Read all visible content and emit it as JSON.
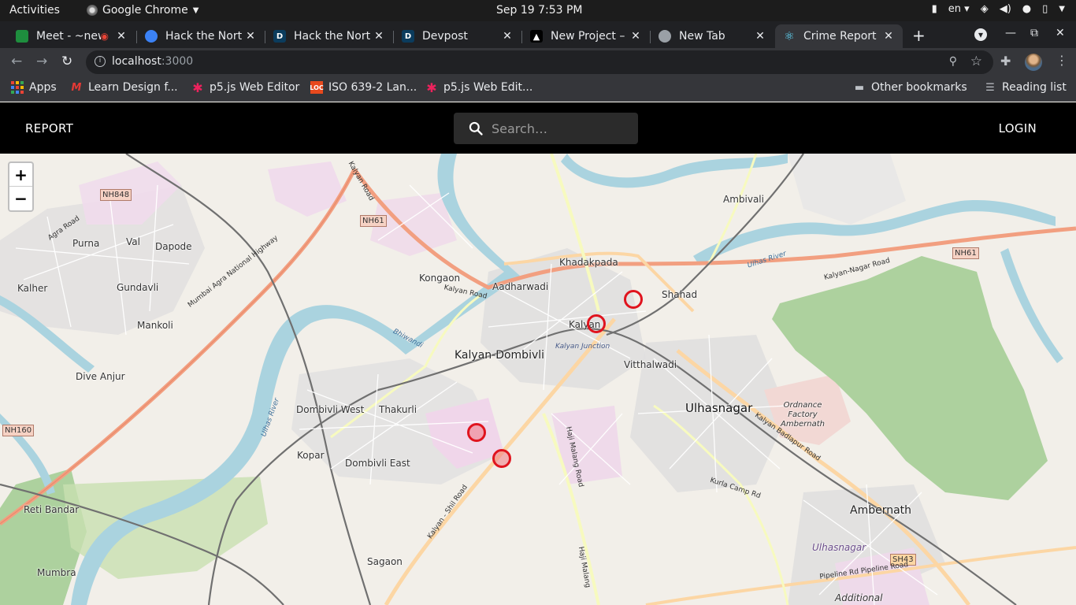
{
  "os_bar": {
    "activities": "Activities",
    "app_name": "Google Chrome",
    "clock": "Sep 19  7:53 PM",
    "lang": "en"
  },
  "tabs": [
    {
      "title": "Meet - ~new",
      "icon": "meet-icon",
      "color": "#1e8e3e"
    },
    {
      "title": "Hack the North",
      "icon": "globe-icon",
      "color": "#3b82f6"
    },
    {
      "title": "Hack the North",
      "icon": "devpost-icon",
      "color": "#0b3c5d"
    },
    {
      "title": "Devpost",
      "icon": "devpost-icon",
      "color": "#0b3c5d"
    },
    {
      "title": "New Project –",
      "icon": "vercel-icon",
      "color": "#000000"
    },
    {
      "title": "New Tab",
      "icon": "chrome-icon",
      "color": "#9aa0a6"
    },
    {
      "title": "Crime Report",
      "icon": "react-icon",
      "color": "#61dafb"
    }
  ],
  "address_bar": {
    "host": "localhost",
    "port": ":3000"
  },
  "bookmarks": [
    {
      "label": "Apps",
      "icon": "apps-grid-icon"
    },
    {
      "label": "Learn Design f...",
      "icon": "design-icon"
    },
    {
      "label": "p5.js Web Editor",
      "icon": "p5-star-icon"
    },
    {
      "label": "ISO 639-2 Lan...",
      "icon": "loc-icon"
    },
    {
      "label": "p5.js Web Edit...",
      "icon": "p5-star-icon"
    },
    {
      "label": "Other bookmarks",
      "icon": "folder-icon"
    },
    {
      "label": "Reading list",
      "icon": "reading-list-icon"
    }
  ],
  "app": {
    "report_label": "REPORT",
    "login_label": "LOGIN",
    "search_placeholder": "Search…"
  },
  "map": {
    "zoom_in": "+",
    "zoom_out": "−",
    "places": [
      {
        "name": "Ambivali"
      },
      {
        "name": "Purna"
      },
      {
        "name": "Val"
      },
      {
        "name": "Dapode"
      },
      {
        "name": "Kalher"
      },
      {
        "name": "Gundavli"
      },
      {
        "name": "Mankoli"
      },
      {
        "name": "Kongaon"
      },
      {
        "name": "Khadakpada"
      },
      {
        "name": "Aadharwadi"
      },
      {
        "name": "Shahad"
      },
      {
        "name": "Kalyan"
      },
      {
        "name": "Kalyan-Dombivli"
      },
      {
        "name": "Vitthalwadi"
      },
      {
        "name": "Dive Anjur"
      },
      {
        "name": "Dombivli West"
      },
      {
        "name": "Thakurli"
      },
      {
        "name": "Ulhasnagar"
      },
      {
        "name": "Kopar"
      },
      {
        "name": "Dombivli East"
      },
      {
        "name": "Reti Bandar"
      },
      {
        "name": "Ambernath"
      },
      {
        "name": "Sagaon"
      },
      {
        "name": "Mumbra"
      },
      {
        "name": "Additional"
      },
      {
        "name": "Ulhasnagar"
      },
      {
        "name": "Ordnance Factory Ambernath"
      }
    ],
    "road_tags": [
      "NH848",
      "NH61",
      "NH61",
      "NH160",
      "SH43"
    ],
    "road_names": [
      "Kalyan Road",
      "Mumbai Agra National Highway",
      "Agra Road",
      "Kalyan Road",
      "Kalyan-Nagar Road",
      "Kalyan - Shil Road",
      "Haji Malang Road",
      "Kalyan Badlapur Road",
      "Kurla Camp Rd",
      "Pipeline Rd Pipeline Road",
      "Ulhas River",
      "Ulhas River",
      "Bhiwandi",
      "Kalyan Junction",
      "Haji Malang"
    ],
    "markers": [
      {
        "filled": false
      },
      {
        "filled": false
      },
      {
        "filled": true
      },
      {
        "filled": true
      }
    ]
  }
}
